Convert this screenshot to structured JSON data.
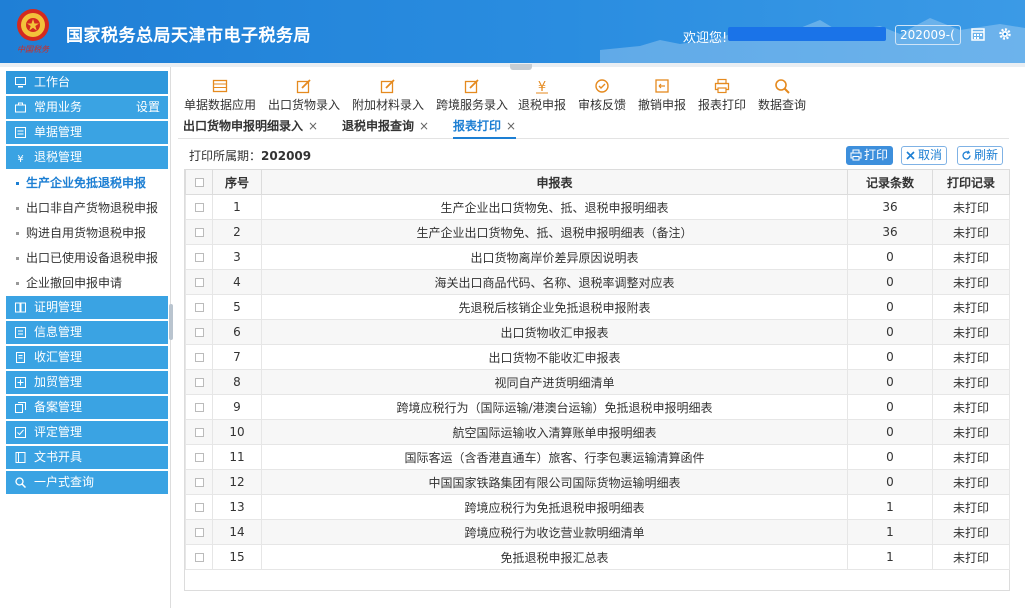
{
  "header": {
    "title": "国家税务总局天津市电子税务局",
    "welcome": "欢迎您!",
    "period": "202009-(",
    "emblem_caption": "中国税务",
    "colors": {
      "bar": "#2a8de0"
    }
  },
  "sidebar": {
    "workbench": "工作台",
    "common": "常用业务",
    "common_setting": "设置",
    "items": [
      {
        "label": "单据管理",
        "icon": "doc-icon"
      },
      {
        "label": "退税管理",
        "icon": "refund-icon"
      }
    ],
    "sub_items": [
      {
        "label": "生产企业免抵退税申报",
        "active": true
      },
      {
        "label": "出口非自产货物退税申报",
        "active": false
      },
      {
        "label": "购进自用货物退税申报",
        "active": false
      },
      {
        "label": "出口已使用设备退税申报",
        "active": false
      },
      {
        "label": "企业撤回申报申请",
        "active": false
      }
    ],
    "groups": [
      {
        "label": "证明管理",
        "icon": "book-icon"
      },
      {
        "label": "信息管理",
        "icon": "info-icon"
      },
      {
        "label": "收汇管理",
        "icon": "receipt-icon"
      },
      {
        "label": "加贸管理",
        "icon": "plus-box-icon"
      },
      {
        "label": "备案管理",
        "icon": "copy-icon"
      },
      {
        "label": "评定管理",
        "icon": "check-icon"
      },
      {
        "label": "文书开具",
        "icon": "document-icon"
      },
      {
        "label": "一户式查询",
        "icon": "search-icon"
      }
    ]
  },
  "toolbar": [
    {
      "label": "单据数据应用",
      "icon": "grid-icon"
    },
    {
      "label": "出口货物录入",
      "icon": "edit-icon"
    },
    {
      "label": "附加材料录入",
      "icon": "edit-icon"
    },
    {
      "label": "跨境服务录入",
      "icon": "edit-icon"
    },
    {
      "label": "退税申报",
      "icon": "yen-icon"
    },
    {
      "label": "审核反馈",
      "icon": "feedback-icon"
    },
    {
      "label": "撤销申报",
      "icon": "undo-icon"
    },
    {
      "label": "报表打印",
      "icon": "print-icon"
    },
    {
      "label": "数据查询",
      "icon": "search-icon"
    }
  ],
  "tabs": [
    {
      "label": "出口货物申报明细录入",
      "active": false
    },
    {
      "label": "退税申报查询",
      "active": false
    },
    {
      "label": "报表打印",
      "active": true
    }
  ],
  "period_label": "打印所属期：",
  "period_value": "202009",
  "buttons": {
    "print": "打印",
    "cancel": "取消",
    "refresh": "刷新"
  },
  "table": {
    "headers": {
      "index": "序号",
      "report": "申报表",
      "count": "记录条数",
      "status": "打印记录"
    },
    "rows": [
      {
        "index": "1",
        "report": "生产企业出口货物免、抵、退税申报明细表",
        "count": "36",
        "status": "未打印"
      },
      {
        "index": "2",
        "report": "生产企业出口货物免、抵、退税申报明细表（备注）",
        "count": "36",
        "status": "未打印"
      },
      {
        "index": "3",
        "report": "出口货物离岸价差异原因说明表",
        "count": "0",
        "status": "未打印"
      },
      {
        "index": "4",
        "report": "海关出口商品代码、名称、退税率调整对应表",
        "count": "0",
        "status": "未打印"
      },
      {
        "index": "5",
        "report": "先退税后核销企业免抵退税申报附表",
        "count": "0",
        "status": "未打印"
      },
      {
        "index": "6",
        "report": "出口货物收汇申报表",
        "count": "0",
        "status": "未打印"
      },
      {
        "index": "7",
        "report": "出口货物不能收汇申报表",
        "count": "0",
        "status": "未打印"
      },
      {
        "index": "8",
        "report": "视同自产进货明细清单",
        "count": "0",
        "status": "未打印"
      },
      {
        "index": "9",
        "report": "跨境应税行为（国际运输/港澳台运输）免抵退税申报明细表",
        "count": "0",
        "status": "未打印"
      },
      {
        "index": "10",
        "report": "航空国际运输收入清算账单申报明细表",
        "count": "0",
        "status": "未打印"
      },
      {
        "index": "11",
        "report": "国际客运（含香港直通车）旅客、行李包裹运输清算函件",
        "count": "0",
        "status": "未打印"
      },
      {
        "index": "12",
        "report": "中国国家铁路集团有限公司国际货物运输明细表",
        "count": "0",
        "status": "未打印"
      },
      {
        "index": "13",
        "report": "跨境应税行为免抵退税申报明细表",
        "count": "1",
        "status": "未打印"
      },
      {
        "index": "14",
        "report": "跨境应税行为收讫营业款明细清单",
        "count": "1",
        "status": "未打印"
      },
      {
        "index": "15",
        "report": "免抵退税申报汇总表",
        "count": "1",
        "status": "未打印"
      }
    ]
  }
}
